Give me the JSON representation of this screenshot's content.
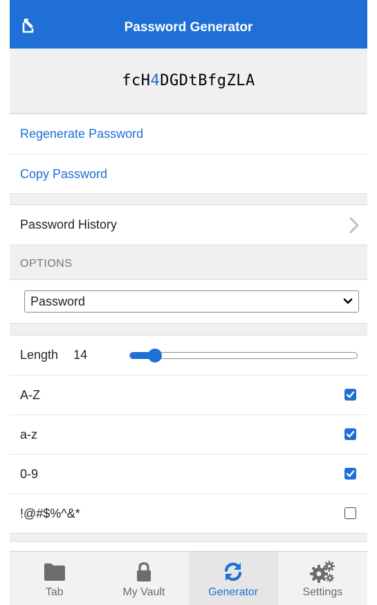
{
  "header": {
    "title": "Password Generator",
    "popout_icon": "popout-arrow-icon"
  },
  "password": {
    "segments": [
      {
        "text": "fcH",
        "type": "letter"
      },
      {
        "text": "4",
        "type": "number"
      },
      {
        "text": "DGDtBfgZLA",
        "type": "letter"
      }
    ]
  },
  "actions": {
    "regenerate": "Regenerate Password",
    "copy": "Copy Password"
  },
  "history": {
    "label": "Password History",
    "icon": "chevron-right-icon"
  },
  "options": {
    "section_label": "OPTIONS",
    "type_select": {
      "value": "Password"
    },
    "length": {
      "label": "Length",
      "value": "14",
      "fraction": 0.11
    },
    "toggles": [
      {
        "label": "A-Z",
        "checked": true
      },
      {
        "label": "a-z",
        "checked": true
      },
      {
        "label": "0-9",
        "checked": true
      },
      {
        "label": "!@#$%^&*",
        "checked": false
      }
    ]
  },
  "tabs": [
    {
      "label": "Tab",
      "icon": "folder-icon",
      "active": false
    },
    {
      "label": "My Vault",
      "icon": "lock-icon",
      "active": false
    },
    {
      "label": "Generator",
      "icon": "refresh-icon",
      "active": true
    },
    {
      "label": "Settings",
      "icon": "gears-icon",
      "active": false
    }
  ],
  "colors": {
    "accent": "#1f6fd6",
    "header_bg": "#1f6fd6",
    "tab_inactive": "#6c6c6c",
    "icon_gray": "#6c6c6c"
  }
}
